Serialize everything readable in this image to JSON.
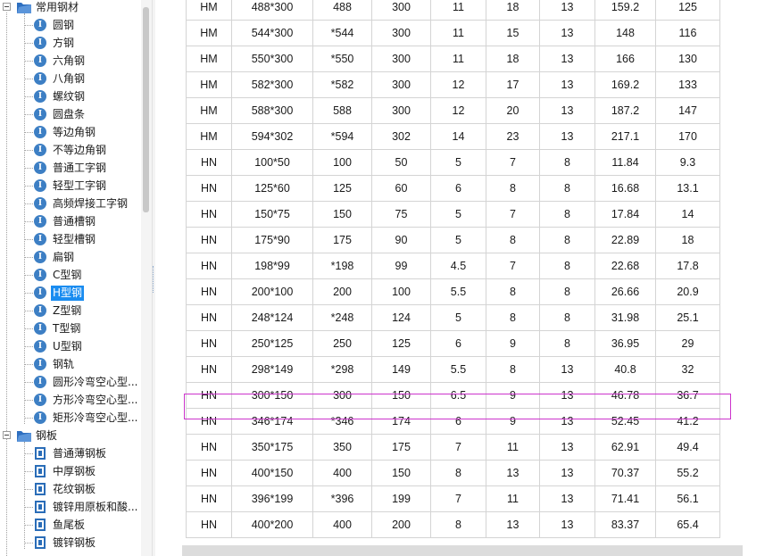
{
  "tree": {
    "groups": [
      {
        "label": "常用钢材",
        "items": [
          {
            "label": "圆钢",
            "icon": "i-beam-circle-icon"
          },
          {
            "label": "方钢",
            "icon": "i-beam-circle-icon"
          },
          {
            "label": "六角钢",
            "icon": "i-beam-circle-icon"
          },
          {
            "label": "八角钢",
            "icon": "i-beam-circle-icon"
          },
          {
            "label": "螺纹钢",
            "icon": "i-beam-circle-icon"
          },
          {
            "label": "圆盘条",
            "icon": "i-beam-circle-icon"
          },
          {
            "label": "等边角钢",
            "icon": "i-beam-circle-icon"
          },
          {
            "label": "不等边角钢",
            "icon": "i-beam-circle-icon"
          },
          {
            "label": "普通工字钢",
            "icon": "i-beam-circle-icon"
          },
          {
            "label": "轻型工字钢",
            "icon": "i-beam-circle-icon"
          },
          {
            "label": "高频焊接工字钢",
            "icon": "i-beam-circle-icon"
          },
          {
            "label": "普通槽钢",
            "icon": "i-beam-circle-icon"
          },
          {
            "label": "轻型槽钢",
            "icon": "i-beam-circle-icon"
          },
          {
            "label": "扁钢",
            "icon": "i-beam-circle-icon"
          },
          {
            "label": "C型钢",
            "icon": "i-beam-circle-icon"
          },
          {
            "label": "H型钢",
            "icon": "i-beam-circle-icon",
            "selected": true
          },
          {
            "label": "Z型钢",
            "icon": "i-beam-circle-icon"
          },
          {
            "label": "T型钢",
            "icon": "i-beam-circle-icon"
          },
          {
            "label": "U型钢",
            "icon": "i-beam-circle-icon"
          },
          {
            "label": "钢轨",
            "icon": "i-beam-circle-icon"
          },
          {
            "label": "圆形冷弯空心型...",
            "icon": "i-beam-circle-icon"
          },
          {
            "label": "方形冷弯空心型...",
            "icon": "i-beam-circle-icon"
          },
          {
            "label": "矩形冷弯空心型...",
            "icon": "i-beam-circle-icon"
          }
        ]
      },
      {
        "label": "钢板",
        "items": [
          {
            "label": "普通薄钢板",
            "icon": "steel-plate-icon"
          },
          {
            "label": "中厚钢板",
            "icon": "steel-plate-icon"
          },
          {
            "label": "花纹钢板",
            "icon": "steel-plate-icon"
          },
          {
            "label": "镀锌用原板和酸...",
            "icon": "steel-plate-icon"
          },
          {
            "label": "鱼尾板",
            "icon": "steel-plate-icon"
          },
          {
            "label": "镀锌钢板",
            "icon": "steel-plate-icon"
          }
        ]
      }
    ]
  },
  "table": {
    "highlighted_row": 15,
    "rows": [
      [
        "HM",
        "488*300",
        "488",
        "300",
        "11",
        "18",
        "13",
        "159.2",
        "125"
      ],
      [
        "HM",
        "544*300",
        "*544",
        "300",
        "11",
        "15",
        "13",
        "148",
        "116"
      ],
      [
        "HM",
        "550*300",
        "*550",
        "300",
        "11",
        "18",
        "13",
        "166",
        "130"
      ],
      [
        "HM",
        "582*300",
        "*582",
        "300",
        "12",
        "17",
        "13",
        "169.2",
        "133"
      ],
      [
        "HM",
        "588*300",
        "588",
        "300",
        "12",
        "20",
        "13",
        "187.2",
        "147"
      ],
      [
        "HM",
        "594*302",
        "*594",
        "302",
        "14",
        "23",
        "13",
        "217.1",
        "170"
      ],
      [
        "HN",
        "100*50",
        "100",
        "50",
        "5",
        "7",
        "8",
        "11.84",
        "9.3"
      ],
      [
        "HN",
        "125*60",
        "125",
        "60",
        "6",
        "8",
        "8",
        "16.68",
        "13.1"
      ],
      [
        "HN",
        "150*75",
        "150",
        "75",
        "5",
        "7",
        "8",
        "17.84",
        "14"
      ],
      [
        "HN",
        "175*90",
        "175",
        "90",
        "5",
        "8",
        "8",
        "22.89",
        "18"
      ],
      [
        "HN",
        "198*99",
        "*198",
        "99",
        "4.5",
        "7",
        "8",
        "22.68",
        "17.8"
      ],
      [
        "HN",
        "200*100",
        "200",
        "100",
        "5.5",
        "8",
        "8",
        "26.66",
        "20.9"
      ],
      [
        "HN",
        "248*124",
        "*248",
        "124",
        "5",
        "8",
        "8",
        "31.98",
        "25.1"
      ],
      [
        "HN",
        "250*125",
        "250",
        "125",
        "6",
        "9",
        "8",
        "36.95",
        "29"
      ],
      [
        "HN",
        "298*149",
        "*298",
        "149",
        "5.5",
        "8",
        "13",
        "40.8",
        "32"
      ],
      [
        "HN",
        "300*150",
        "300",
        "150",
        "6.5",
        "9",
        "13",
        "46.78",
        "36.7"
      ],
      [
        "HN",
        "346*174",
        "*346",
        "174",
        "6",
        "9",
        "13",
        "52.45",
        "41.2"
      ],
      [
        "HN",
        "350*175",
        "350",
        "175",
        "7",
        "11",
        "13",
        "62.91",
        "49.4"
      ],
      [
        "HN",
        "400*150",
        "400",
        "150",
        "8",
        "13",
        "13",
        "70.37",
        "55.2"
      ],
      [
        "HN",
        "396*199",
        "*396",
        "199",
        "7",
        "11",
        "13",
        "71.41",
        "56.1"
      ],
      [
        "HN",
        "400*200",
        "400",
        "200",
        "8",
        "13",
        "13",
        "83.37",
        "65.4"
      ]
    ]
  },
  "colors": {
    "selection": "#1a8cf0",
    "highlight_border": "#cc33cc",
    "grid_line": "#d4d4d4",
    "folder": "#2e6fc0",
    "icon_blue": "#3d7fc4"
  }
}
